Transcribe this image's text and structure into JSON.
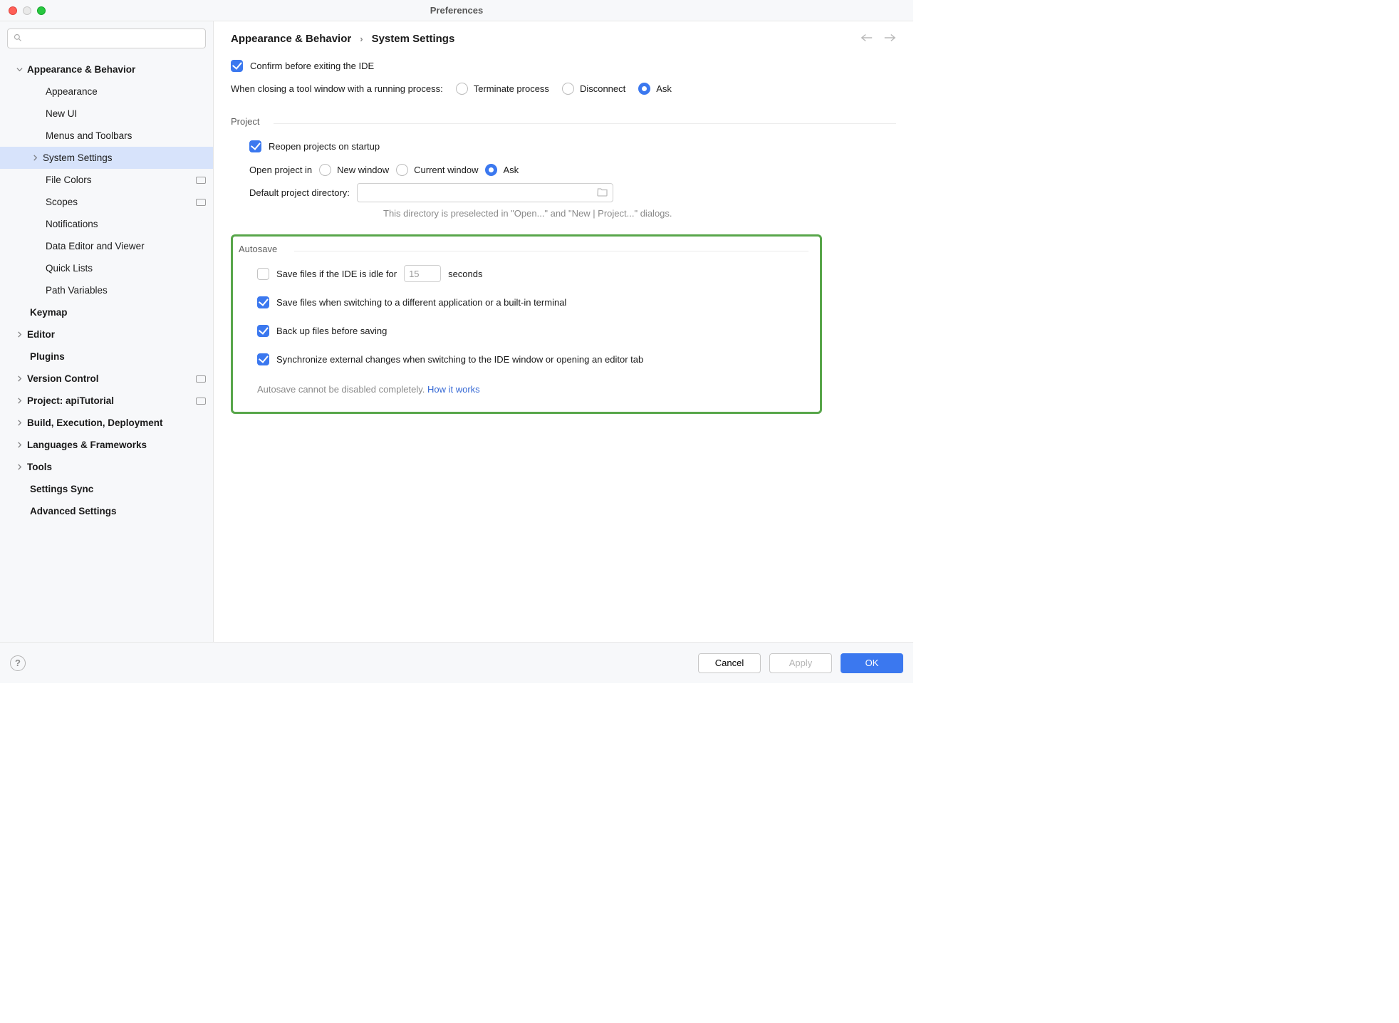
{
  "window_title": "Preferences",
  "search_placeholder": "",
  "breadcrumb": {
    "a": "Appearance & Behavior",
    "b": "System Settings"
  },
  "sidebar": {
    "appearance_behavior": "Appearance & Behavior",
    "appearance": "Appearance",
    "new_ui": "New UI",
    "menus": "Menus and Toolbars",
    "system_settings": "System Settings",
    "file_colors": "File Colors",
    "scopes": "Scopes",
    "notifications": "Notifications",
    "data_editor": "Data Editor and Viewer",
    "quick_lists": "Quick Lists",
    "path_vars": "Path Variables",
    "keymap": "Keymap",
    "editor": "Editor",
    "plugins": "Plugins",
    "vcs": "Version Control",
    "project": "Project: apiTutorial",
    "build": "Build, Execution, Deployment",
    "lang": "Languages & Frameworks",
    "tools": "Tools",
    "settings_sync": "Settings Sync",
    "advanced": "Advanced Settings"
  },
  "main": {
    "confirm_exit": "Confirm before exiting the IDE",
    "close_label": "When closing a tool window with a running process:",
    "close_opts": {
      "terminate": "Terminate process",
      "disconnect": "Disconnect",
      "ask": "Ask"
    },
    "project_title": "Project",
    "reopen": "Reopen projects on startup",
    "open_in_label": "Open project in",
    "open_in_opts": {
      "new": "New window",
      "current": "Current window",
      "ask": "Ask"
    },
    "dir_label": "Default project directory:",
    "dir_hint": "This directory is preselected in \"Open...\" and \"New | Project...\" dialogs."
  },
  "autosave": {
    "title": "Autosave",
    "idle_a": "Save files if the IDE is idle for",
    "idle_val": "15",
    "idle_b": "seconds",
    "switch": "Save files when switching to a different application or a built-in terminal",
    "backup": "Back up files before saving",
    "sync": "Synchronize external changes when switching to the IDE window or opening an editor tab",
    "note": "Autosave cannot be disabled completely. ",
    "link": "How it works"
  },
  "buttons": {
    "cancel": "Cancel",
    "apply": "Apply",
    "ok": "OK"
  }
}
